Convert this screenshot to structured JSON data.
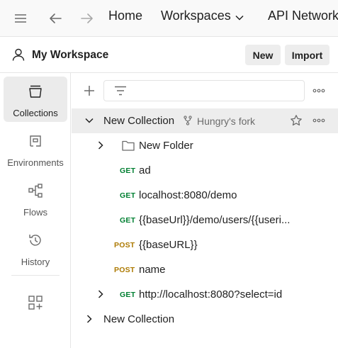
{
  "topbar": {
    "home": "Home",
    "workspaces": "Workspaces",
    "api_network": "API Network"
  },
  "workspace": {
    "title": "My Workspace",
    "new_button": "New",
    "import_button": "Import"
  },
  "sidebar": {
    "items": [
      {
        "label": "Collections",
        "icon": "collections-icon",
        "active": true
      },
      {
        "label": "Environments",
        "icon": "environments-icon"
      },
      {
        "label": "Flows",
        "icon": "flows-icon"
      },
      {
        "label": "History",
        "icon": "history-icon"
      }
    ]
  },
  "collection": {
    "name": "New Collection",
    "fork_label": "Hungry's fork"
  },
  "tree": [
    {
      "type": "folder",
      "label": "New Folder"
    },
    {
      "type": "request",
      "method": "GET",
      "label": "ad"
    },
    {
      "type": "request",
      "method": "GET",
      "label": "localhost:8080/demo"
    },
    {
      "type": "request",
      "method": "GET",
      "label": "{{baseUrl}}/demo/users/{{useri..."
    },
    {
      "type": "request",
      "method": "POST",
      "label": "{{baseURL}}"
    },
    {
      "type": "request",
      "method": "POST",
      "label": "name"
    },
    {
      "type": "request",
      "method": "GET",
      "label": "http://localhost:8080?select=id"
    }
  ],
  "collection2": {
    "name": "New Collection"
  },
  "colors": {
    "get": "#007f31",
    "post": "#ad7a03",
    "selected_row": "#ededed"
  }
}
